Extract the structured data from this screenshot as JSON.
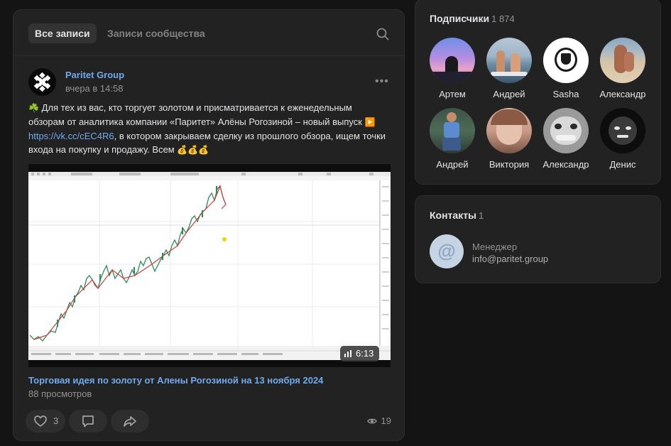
{
  "wall": {
    "tabs": [
      {
        "label": "Все записи"
      },
      {
        "label": "Записи сообщества"
      }
    ]
  },
  "post": {
    "author": "Paritet Group",
    "time": "вчера в 14:58",
    "text_part1": " Для тех из вас, кто торгует золотом и присматривается к еженедельным обзорам от аналитика компании «Паритет» Алёны Рогозиной – новый выпуск ",
    "link": "https://vk.cc/cEC4R6",
    "text_part2": ", в котором закрываем сделку из прошлого обзора, ищем точки входа на покупку и продажу. Всем ",
    "emoji_lead": "☘️",
    "emoji_play": "▶️",
    "emoji_money": "💰💰💰",
    "video": {
      "duration": "6:13",
      "title": "Торговая идея по золоту от Алены Рогозиной на 13 ноября 2024",
      "views": "88 просмотров"
    },
    "likes": "3",
    "views": "19"
  },
  "followers": {
    "title": "Подписчики",
    "count": "1 874",
    "items": [
      {
        "name": "Артем"
      },
      {
        "name": "Андрей"
      },
      {
        "name": "Sasha"
      },
      {
        "name": "Александр"
      },
      {
        "name": "Андрей"
      },
      {
        "name": "Виктория"
      },
      {
        "name": "Александр"
      },
      {
        "name": "Денис"
      }
    ]
  },
  "contacts": {
    "title": "Контакты",
    "count": "1",
    "role": "Менеджер",
    "email": "info@paritet.group"
  },
  "colors": {
    "accent": "#71aaeb",
    "panel_bg": "#222222",
    "page_bg": "#141414"
  }
}
